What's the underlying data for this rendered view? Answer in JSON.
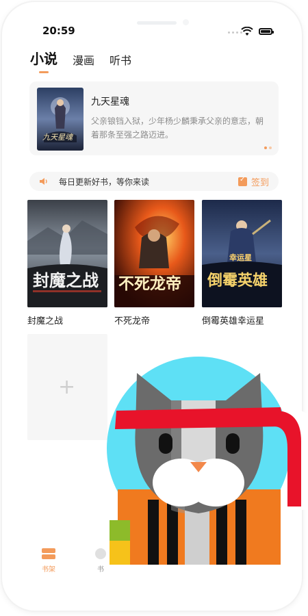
{
  "status_bar": {
    "time": "20:59"
  },
  "tabs": [
    {
      "label": "小说",
      "active": true
    },
    {
      "label": "漫画",
      "active": false
    },
    {
      "label": "听书",
      "active": false
    }
  ],
  "featured": {
    "title": "九天星魂",
    "description": "父亲锒铛入狱，少年杨少麟秉承父亲的意志，朝着那条至强之路迈进。",
    "pager_count": 2,
    "pager_active": 0
  },
  "notice": {
    "icon": "speaker-icon",
    "text": "每日更新好书，等你来读",
    "signin_label": "签到"
  },
  "books": [
    {
      "title": "封魔之战"
    },
    {
      "title": "不死龙帝"
    },
    {
      "title": "倒霉英雄幸运星"
    }
  ],
  "add_book": {
    "icon": "plus-icon"
  },
  "bottom_nav": [
    {
      "label": "书架",
      "icon": "bookshelf-icon",
      "active": true
    },
    {
      "label": "书",
      "icon": "bookstore-icon",
      "active": false
    }
  ],
  "colors": {
    "accent": "#f39b5b",
    "card_bg": "#f6f6f6"
  }
}
